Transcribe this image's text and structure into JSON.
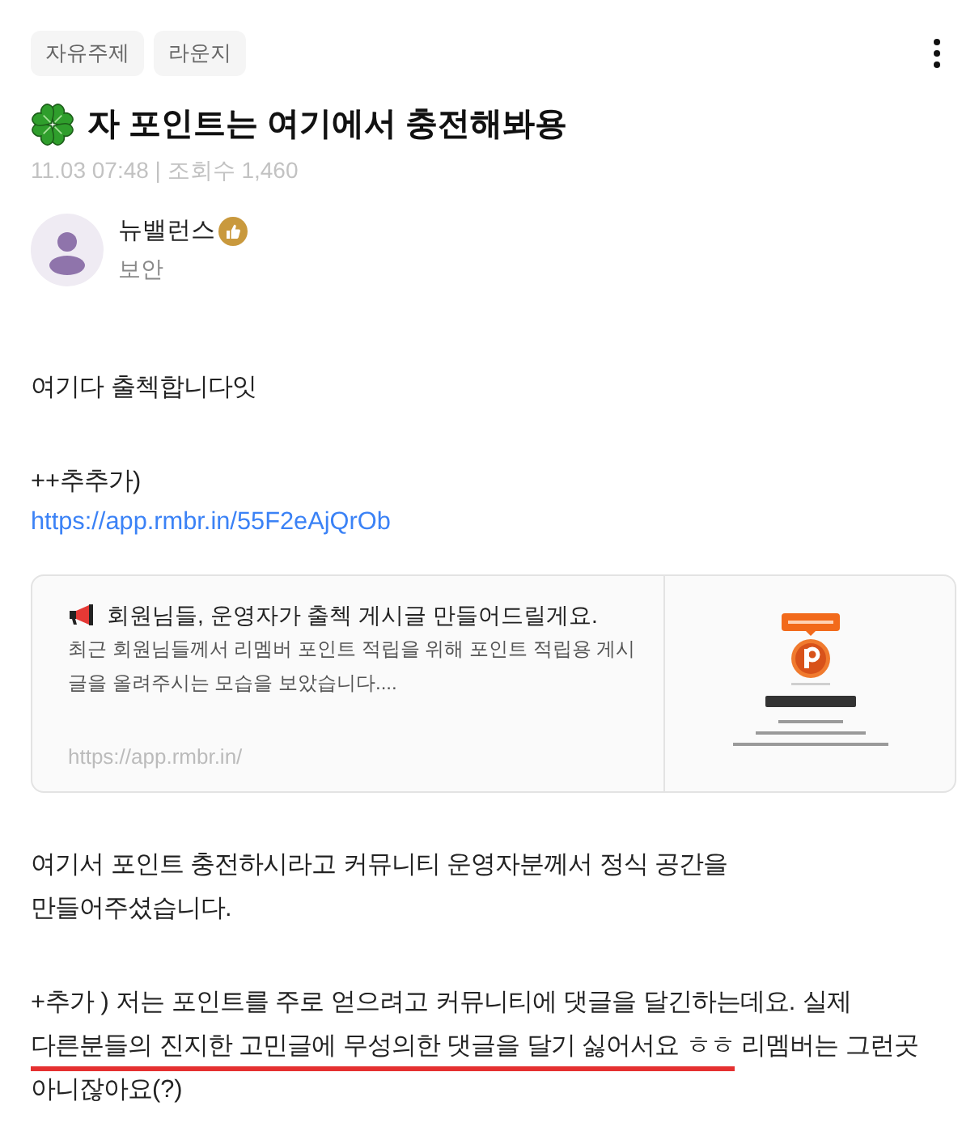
{
  "tags": [
    {
      "label": "자유주제"
    },
    {
      "label": "라운지"
    }
  ],
  "post": {
    "title": "자 포인트는 여기에서 충전해봐용",
    "meta": "11.03 07:48 | 조회수 1,460"
  },
  "author": {
    "name": "뉴밸런스",
    "subtitle": "보안"
  },
  "body": [
    {
      "kind": "paragraph",
      "lines": [
        {
          "kind": "text",
          "text": "여기다 출첵합니다잇"
        }
      ]
    },
    {
      "kind": "paragraph",
      "lines": [
        {
          "kind": "text",
          "text": "++추추가)"
        },
        {
          "kind": "link",
          "text": "https://app.rmbr.in/55F2eAjQrOb"
        }
      ]
    },
    {
      "kind": "preview",
      "title": "회원님들, 운영자가 출첵 게시글 만들어드릴게요.",
      "description": "최근 회원님들께서 리멤버 포인트 적립을 위해 포인트 적립용 게시글을 올려주시는 모습을 보았습니다....",
      "url": "https://app.rmbr.in/"
    },
    {
      "kind": "paragraph",
      "lines": [
        {
          "kind": "text",
          "text": "여기서 포인트 충전하시라고 커뮤니티 운영자분께서 정식 공간을 만들어주셨습니다."
        }
      ]
    },
    {
      "kind": "paragraph",
      "lines": [
        {
          "kind": "text",
          "segments": [
            {
              "text": "+추가 ) 저는 포인트를 주로 얻으려고 커뮤니티에 댓글을 달긴하는데요. 실제 ",
              "underlined": false
            },
            {
              "text": "다른분들의 진지한 고민글에 무성의한 댓글을 달기 싫어서요 ㅎㅎ",
              "underlined": true
            },
            {
              "text": " 리멤버는 그런곳 아니잖아요(?)",
              "underlined": false
            }
          ]
        }
      ]
    }
  ]
}
